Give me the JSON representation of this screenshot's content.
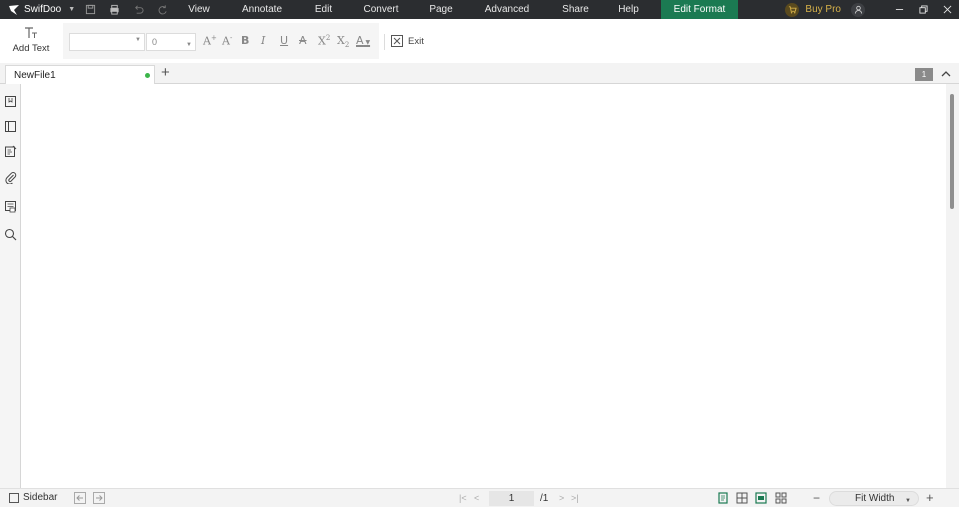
{
  "app": {
    "name": "SwifDoo",
    "colors": {
      "titlebar": "#2b2d30",
      "active_menu": "#1b7a52",
      "buy_pro": "#d7b24a",
      "unsaved_dot": "#3bb54a"
    }
  },
  "quick_access": [
    "save-icon",
    "print-icon",
    "undo-icon",
    "redo-icon"
  ],
  "menu": [
    {
      "label": "View",
      "active": false
    },
    {
      "label": "Annotate",
      "active": false
    },
    {
      "label": "Edit",
      "active": false
    },
    {
      "label": "Convert",
      "active": false
    },
    {
      "label": "Page",
      "active": false
    },
    {
      "label": "Advanced",
      "active": false
    },
    {
      "label": "Share",
      "active": false
    },
    {
      "label": "Help",
      "active": false
    },
    {
      "label": "Edit Format",
      "active": true
    }
  ],
  "account": {
    "buy_label": "Buy Pro"
  },
  "toolbar": {
    "add_text_label": "Add Text",
    "font_value": "",
    "size_value": "0",
    "format_buttons": [
      "increase-font-size",
      "decrease-font-size",
      "bold",
      "italic",
      "underline",
      "strikethrough",
      "superscript",
      "subscript",
      "font-color"
    ],
    "exit_label": "Exit"
  },
  "tabs": [
    {
      "label": "NewFile1",
      "unsaved": true
    }
  ],
  "tab_page_count": "1",
  "left_rail": [
    "bookmark-icon",
    "thumbnail-icon",
    "annotation-list-icon",
    "attachment-icon",
    "form-fields-icon",
    "search-icon"
  ],
  "statusbar": {
    "sidebar_label": "Sidebar",
    "current_page": "1",
    "total_pages": "/1",
    "zoom": "Fit Width"
  }
}
